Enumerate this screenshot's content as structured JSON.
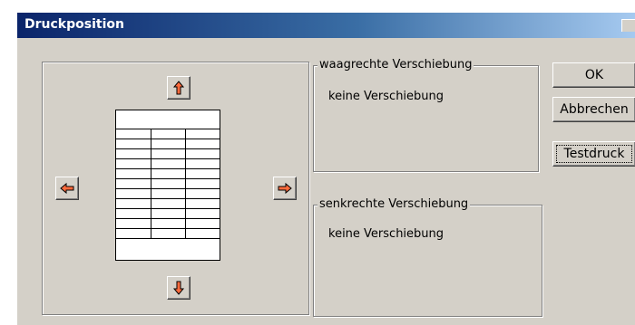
{
  "window": {
    "title": "Druckposition"
  },
  "position": {
    "horizontal_group": {
      "label": "waagrechte Verschiebung",
      "value": "keine Verschiebung"
    },
    "vertical_group": {
      "label": "senkrechte Verschiebung",
      "value": "keine Verschiebung"
    }
  },
  "buttons": {
    "ok": "OK",
    "cancel": "Abbrechen",
    "test": "Testdruck"
  },
  "icons": {
    "up": "arrow-up-icon",
    "down": "arrow-down-icon",
    "left": "arrow-left-icon",
    "right": "arrow-right-icon",
    "page": "page-preview-icon"
  },
  "colors": {
    "arrow": "#ff6a3c",
    "titlebar_start": "#0a246a",
    "titlebar_end": "#a6caf0"
  }
}
